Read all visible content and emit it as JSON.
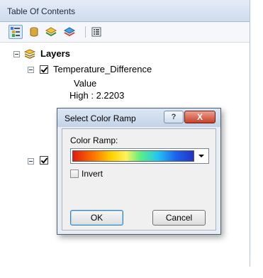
{
  "toc": {
    "title": "Table Of Contents",
    "toolbar": [
      {
        "name": "list-by-drawing-order-icon",
        "active": true
      },
      {
        "name": "list-by-source-icon"
      },
      {
        "name": "list-by-visibility-icon"
      },
      {
        "name": "list-by-selection-icon"
      },
      {
        "name": "options-icon"
      }
    ],
    "tree": {
      "root_label": "Layers",
      "layer_label": "Temperature_Difference",
      "legend_heading": "Value",
      "legend_high": "High : 2.2203"
    }
  },
  "dialog": {
    "title": "Select Color Ramp",
    "help_label": "?",
    "close_label": "X",
    "color_ramp_label": "Color Ramp:",
    "invert_label": "Invert",
    "invert_checked": false,
    "ok_label": "OK",
    "cancel_label": "Cancel",
    "selected_ramp": "red-yellow-green-blue spectrum"
  }
}
